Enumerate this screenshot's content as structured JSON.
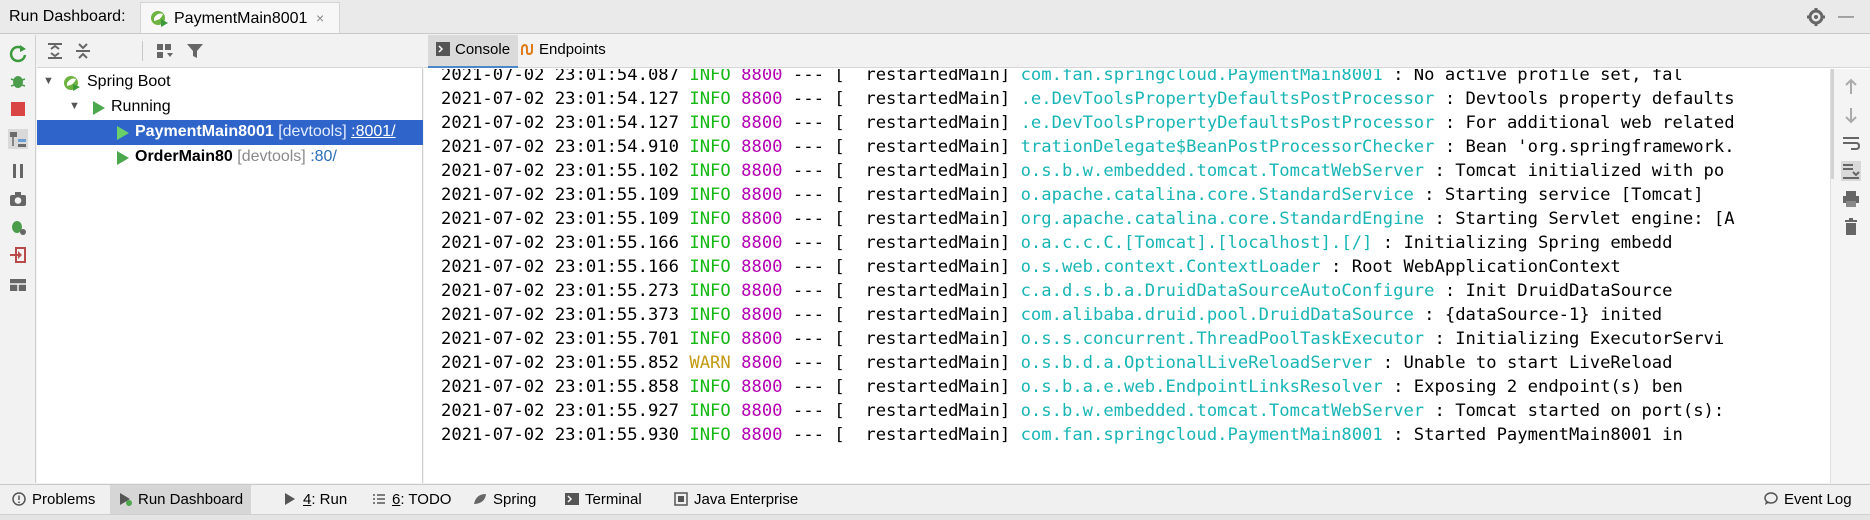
{
  "titlebar": {
    "title": "Run Dashboard:",
    "tab_label": "PaymentMain8001",
    "close_glyph": "×",
    "settings_icon": "gear-icon",
    "hide_glyph": "—"
  },
  "tree": {
    "root_label": "Spring Boot",
    "group_label": "Running",
    "items": [
      {
        "name": "PaymentMain8001",
        "devtools": "[devtools]",
        "port": ":8001/",
        "selected": true
      },
      {
        "name": "OrderMain80",
        "devtools": "[devtools]",
        "port": ":80/",
        "selected": false
      }
    ]
  },
  "tabs": {
    "console": "Console",
    "endpoints": "Endpoints"
  },
  "log": [
    {
      "ts": "2021-07-02 23:01:54.087",
      "level": "INFO",
      "pid": "8800",
      "sep": "---",
      "thread": "[  restartedMain]",
      "logger": "com.fan.springcloud.PaymentMain8001",
      "msg": ": No active profile set, fal"
    },
    {
      "ts": "2021-07-02 23:01:54.127",
      "level": "INFO",
      "pid": "8800",
      "sep": "---",
      "thread": "[  restartedMain]",
      "logger": ".e.DevToolsPropertyDefaultsPostProcessor",
      "msg": ": Devtools property defaults"
    },
    {
      "ts": "2021-07-02 23:01:54.127",
      "level": "INFO",
      "pid": "8800",
      "sep": "---",
      "thread": "[  restartedMain]",
      "logger": ".e.DevToolsPropertyDefaultsPostProcessor",
      "msg": ": For additional web related"
    },
    {
      "ts": "2021-07-02 23:01:54.910",
      "level": "INFO",
      "pid": "8800",
      "sep": "---",
      "thread": "[  restartedMain]",
      "logger": "trationDelegate$BeanPostProcessorChecker",
      "msg": ": Bean 'org.springframework."
    },
    {
      "ts": "2021-07-02 23:01:55.102",
      "level": "INFO",
      "pid": "8800",
      "sep": "---",
      "thread": "[  restartedMain]",
      "logger": "o.s.b.w.embedded.tomcat.TomcatWebServer",
      "msg": ": Tomcat initialized with po"
    },
    {
      "ts": "2021-07-02 23:01:55.109",
      "level": "INFO",
      "pid": "8800",
      "sep": "---",
      "thread": "[  restartedMain]",
      "logger": "o.apache.catalina.core.StandardService",
      "msg": ": Starting service [Tomcat]"
    },
    {
      "ts": "2021-07-02 23:01:55.109",
      "level": "INFO",
      "pid": "8800",
      "sep": "---",
      "thread": "[  restartedMain]",
      "logger": "org.apache.catalina.core.StandardEngine",
      "msg": ": Starting Servlet engine: [A"
    },
    {
      "ts": "2021-07-02 23:01:55.166",
      "level": "INFO",
      "pid": "8800",
      "sep": "---",
      "thread": "[  restartedMain]",
      "logger": "o.a.c.c.C.[Tomcat].[localhost].[/]",
      "msg": ": Initializing Spring embedd"
    },
    {
      "ts": "2021-07-02 23:01:55.166",
      "level": "INFO",
      "pid": "8800",
      "sep": "---",
      "thread": "[  restartedMain]",
      "logger": "o.s.web.context.ContextLoader",
      "msg": ": Root WebApplicationContext"
    },
    {
      "ts": "2021-07-02 23:01:55.273",
      "level": "INFO",
      "pid": "8800",
      "sep": "---",
      "thread": "[  restartedMain]",
      "logger": "c.a.d.s.b.a.DruidDataSourceAutoConfigure",
      "msg": ": Init DruidDataSource"
    },
    {
      "ts": "2021-07-02 23:01:55.373",
      "level": "INFO",
      "pid": "8800",
      "sep": "---",
      "thread": "[  restartedMain]",
      "logger": "com.alibaba.druid.pool.DruidDataSource",
      "msg": ": {dataSource-1} inited"
    },
    {
      "ts": "2021-07-02 23:01:55.701",
      "level": "INFO",
      "pid": "8800",
      "sep": "---",
      "thread": "[  restartedMain]",
      "logger": "o.s.s.concurrent.ThreadPoolTaskExecutor",
      "msg": ": Initializing ExecutorServi"
    },
    {
      "ts": "2021-07-02 23:01:55.852",
      "level": "WARN",
      "pid": "8800",
      "sep": "---",
      "thread": "[  restartedMain]",
      "logger": "o.s.b.d.a.OptionalLiveReloadServer",
      "msg": ": Unable to start LiveReload"
    },
    {
      "ts": "2021-07-02 23:01:55.858",
      "level": "INFO",
      "pid": "8800",
      "sep": "---",
      "thread": "[  restartedMain]",
      "logger": "o.s.b.a.e.web.EndpointLinksResolver",
      "msg": ": Exposing 2 endpoint(s) ben"
    },
    {
      "ts": "2021-07-02 23:01:55.927",
      "level": "INFO",
      "pid": "8800",
      "sep": "---",
      "thread": "[  restartedMain]",
      "logger": "o.s.b.w.embedded.tomcat.TomcatWebServer",
      "msg": ": Tomcat started on port(s):"
    },
    {
      "ts": "2021-07-02 23:01:55.930",
      "level": "INFO",
      "pid": "8800",
      "sep": "---",
      "thread": "[  restartedMain]",
      "logger": "com.fan.springcloud.PaymentMain8001",
      "msg": ": Started PaymentMain8001 in"
    }
  ],
  "bottombar": {
    "problems": "Problems",
    "run_dashboard": "Run Dashboard",
    "run_num": "4",
    "run_label": ": Run",
    "todo_num": "6",
    "todo_label": ": TODO",
    "spring": "Spring",
    "terminal": "Terminal",
    "java_enterprise": "Java Enterprise",
    "event_log": "Event Log"
  },
  "colors": {
    "info": "#14b814",
    "warn": "#c49a16",
    "pid": "#b400b4",
    "logger": "#19b5b5",
    "selection": "#2f65ca"
  }
}
